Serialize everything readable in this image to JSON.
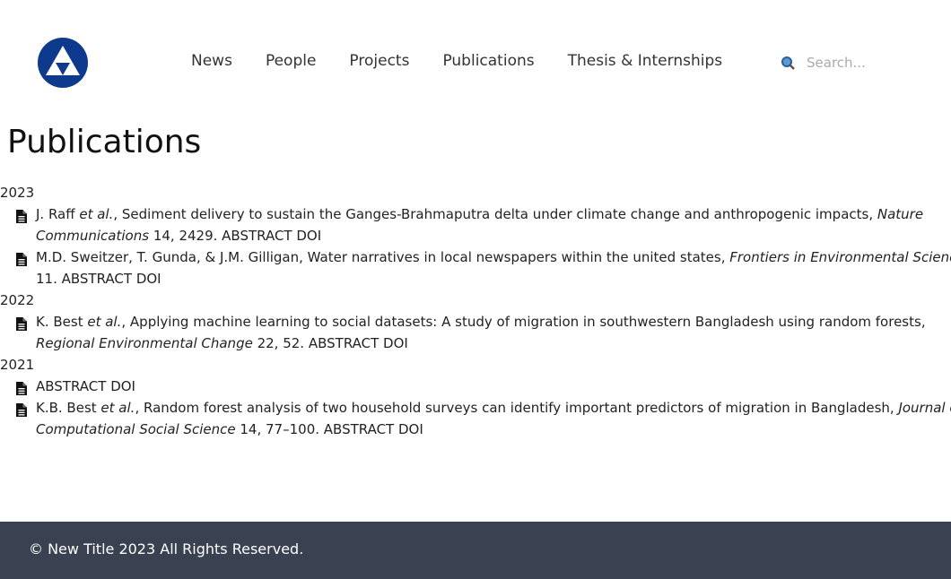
{
  "header": {
    "logo_alt": "Logo",
    "nav": [
      "News",
      "People",
      "Projects",
      "Publications",
      "Thesis & Internships"
    ],
    "search_placeholder": "Search..."
  },
  "page_title": "Publications",
  "years": [
    {
      "year": "2023",
      "items": [
        {
          "authors": "J. Raff ",
          "etal": "et al.",
          "title": ", Sediment delivery to sustain the Ganges-Brahmaputra delta under climate change and anthropogenic impacts, ",
          "journal": "Nature Communications",
          "rest": " 14, 2429. ",
          "abstract": "ABSTRACT",
          "doi": "DOI"
        },
        {
          "authors": "M.D. Sweitzer, T. Gunda, & J.M. Gilligan",
          "etal": "",
          "title": ", Water narratives in local newspapers within the united states, ",
          "journal": "Frontiers in Environmental Science",
          "rest": " 11. ",
          "abstract": "ABSTRACT",
          "doi": "DOI"
        }
      ]
    },
    {
      "year": "2022",
      "items": [
        {
          "authors": "K. Best ",
          "etal": "et al.",
          "title": ", Applying machine learning to social datasets: A study of migration in southwestern Bangladesh using random forests, ",
          "journal": "Regional Environmental Change",
          "rest": " 22, 52. ",
          "abstract": "ABSTRACT",
          "doi": "DOI"
        }
      ]
    },
    {
      "year": "2021",
      "items": [
        {
          "authors": "",
          "etal": "",
          "title": "",
          "journal": "",
          "rest": "",
          "abstract": "ABSTRACT",
          "doi": "DOI"
        },
        {
          "authors": "K.B. Best ",
          "etal": "et al.",
          "title": ", Random forest analysis of two household surveys can identify important predictors of migration in Bangladesh, ",
          "journal": "Journal of Computational Social Science",
          "rest": " 14, 77–100. ",
          "abstract": "ABSTRACT",
          "doi": "DOI"
        }
      ]
    }
  ],
  "footer": {
    "text": "© New Title 2023 All Rights Reserved."
  },
  "colors": {
    "logo": "#0d3a8c",
    "footer_bg": "#3a4150"
  }
}
